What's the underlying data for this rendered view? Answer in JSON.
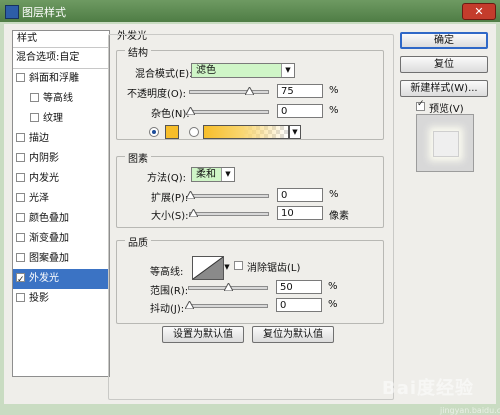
{
  "window": {
    "title": "图层样式",
    "close_label": "✕"
  },
  "left_panel": {
    "header": "样式",
    "blend_options": "混合选项:自定",
    "items": [
      {
        "label": "斜面和浮雕",
        "checked": false,
        "indent": false
      },
      {
        "label": "等高线",
        "checked": false,
        "indent": true
      },
      {
        "label": "纹理",
        "checked": false,
        "indent": true
      },
      {
        "label": "描边",
        "checked": false,
        "indent": false
      },
      {
        "label": "内阴影",
        "checked": false,
        "indent": false
      },
      {
        "label": "内发光",
        "checked": false,
        "indent": false
      },
      {
        "label": "光泽",
        "checked": false,
        "indent": false
      },
      {
        "label": "颜色叠加",
        "checked": false,
        "indent": false
      },
      {
        "label": "渐变叠加",
        "checked": false,
        "indent": false
      },
      {
        "label": "图案叠加",
        "checked": false,
        "indent": false
      },
      {
        "label": "外发光",
        "checked": true,
        "indent": false,
        "selected": true
      },
      {
        "label": "投影",
        "checked": false,
        "indent": false
      }
    ]
  },
  "main": {
    "title": "外发光",
    "structure": {
      "legend": "结构",
      "blend_mode_label": "混合模式(E):",
      "blend_mode_value": "滤色",
      "opacity_label": "不透明度(O):",
      "opacity_value": "75",
      "opacity_pct": 0.75,
      "noise_label": "杂色(N):",
      "noise_value": "0",
      "noise_pct": 0,
      "unit": "%"
    },
    "elements": {
      "legend": "图素",
      "technique_label": "方法(Q):",
      "technique_value": "柔和",
      "spread_label": "扩展(P):",
      "spread_value": "0",
      "spread_pct": 0,
      "size_label": "大小(S):",
      "size_value": "10",
      "size_pct": 0.04,
      "pct_unit": "%",
      "px_unit": "像素"
    },
    "quality": {
      "legend": "品质",
      "contour_label": "等高线:",
      "antialias_label": "消除锯齿(L)",
      "range_label": "范围(R):",
      "range_value": "50",
      "range_pct": 0.5,
      "jitter_label": "抖动(J):",
      "jitter_value": "0",
      "jitter_pct": 0,
      "unit": "%"
    },
    "set_default": "设置为默认值",
    "reset_default": "复位为默认值"
  },
  "right": {
    "ok": "确定",
    "reset": "复位",
    "new_style": "新建样式(W)...",
    "preview_label": "预览(V)",
    "preview_checked": true
  },
  "colors": {
    "glow": "#f7be2a",
    "accent": "#3b73c4"
  },
  "watermark": {
    "text": "Bai度经验",
    "sub": "jingyan.baidu.com"
  }
}
